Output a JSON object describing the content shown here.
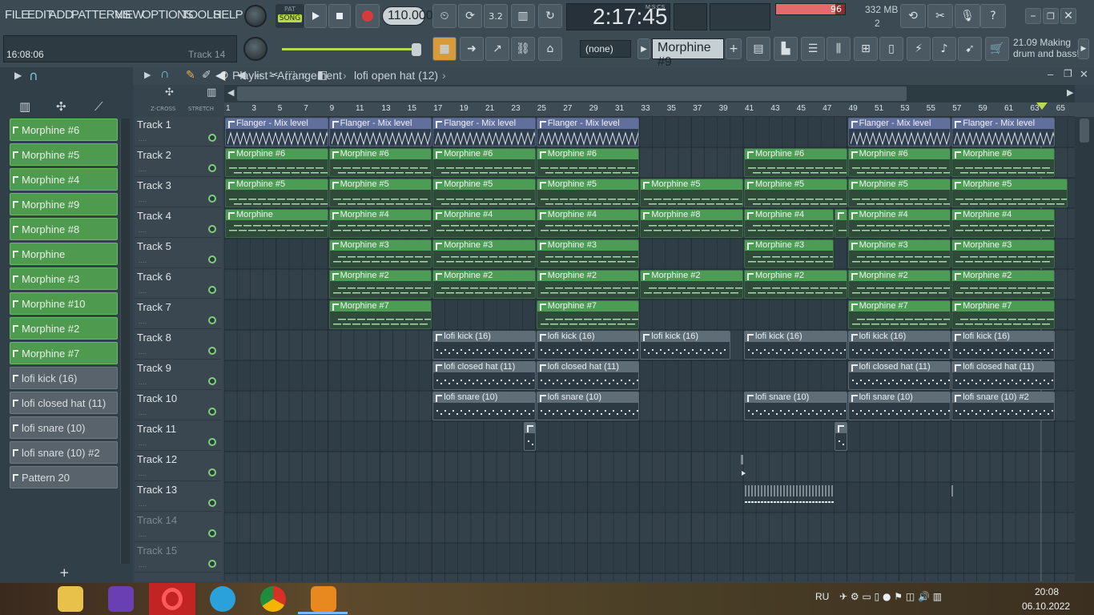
{
  "menu": [
    "FILE",
    "EDIT",
    "ADD",
    "PATTERNS",
    "VIEW",
    "OPTIONS",
    "TOOLS",
    "HELP"
  ],
  "transport": {
    "pat_label": "PAT",
    "song_label": "SONG",
    "tempo": "110.000",
    "time": "2:17:45",
    "time_unit": "M:S:CS"
  },
  "cpu": {
    "percent": "96",
    "memory": "332 MB",
    "voices": "2"
  },
  "status": {
    "clock": "16:08:06",
    "track_hint": "Track 14"
  },
  "pattern_selector": {
    "snap": "(none)",
    "current": "Morphine #9"
  },
  "hint_panel": {
    "line1": "21.09  Making",
    "line2": "drum and bass!"
  },
  "playlist": {
    "title": "Playlist - Arrangement",
    "breadcrumb": "lofi open hat (12)",
    "zcross": "Z-CROSS",
    "stretch": "STRETCH"
  },
  "browser_patterns": [
    {
      "label": "Morphine #6",
      "kind": "g"
    },
    {
      "label": "Morphine #5",
      "kind": "g"
    },
    {
      "label": "Morphine #4",
      "kind": "g"
    },
    {
      "label": "Morphine #9",
      "kind": "g"
    },
    {
      "label": "Morphine #8",
      "kind": "g"
    },
    {
      "label": "Morphine",
      "kind": "g"
    },
    {
      "label": "Morphine #3",
      "kind": "g"
    },
    {
      "label": "Morphine #10",
      "kind": "g"
    },
    {
      "label": "Morphine #2",
      "kind": "g"
    },
    {
      "label": "Morphine #7",
      "kind": "g"
    },
    {
      "label": "lofi kick (16)",
      "kind": "a"
    },
    {
      "label": "lofi closed hat (11)",
      "kind": "a"
    },
    {
      "label": "lofi snare (10)",
      "kind": "a"
    },
    {
      "label": "lofi snare (10) #2",
      "kind": "a"
    },
    {
      "label": "Pattern 20",
      "kind": "a"
    }
  ],
  "ruler_ticks": [
    "1",
    "3",
    "5",
    "7",
    "9",
    "11",
    "13",
    "15",
    "17",
    "19",
    "21",
    "23",
    "25",
    "27",
    "29",
    "31",
    "33",
    "35",
    "37",
    "39",
    "41",
    "43",
    "45",
    "47",
    "49",
    "51",
    "53",
    "55",
    "57",
    "59",
    "61",
    "63",
    "65"
  ],
  "tracks": [
    "Track 1",
    "Track 2",
    "Track 3",
    "Track 4",
    "Track 5",
    "Track 6",
    "Track 7",
    "Track 8",
    "Track 9",
    "Track 10",
    "Track 11",
    "Track 12",
    "Track 13",
    "Track 14",
    "Track 15"
  ],
  "clips": [
    {
      "track": 1,
      "start": 1,
      "len": 8,
      "label": "Flanger - Mix level",
      "kind": "f"
    },
    {
      "track": 1,
      "start": 9,
      "len": 8,
      "label": "Flanger - Mix level",
      "kind": "f"
    },
    {
      "track": 1,
      "start": 17,
      "len": 8,
      "label": "Flanger - Mix level",
      "kind": "f"
    },
    {
      "track": 1,
      "start": 25,
      "len": 8,
      "label": "Flanger - Mix level",
      "kind": "f"
    },
    {
      "track": 1,
      "start": 49,
      "len": 8,
      "label": "Flanger - Mix level",
      "kind": "f"
    },
    {
      "track": 1,
      "start": 57,
      "len": 8,
      "label": "Flanger - Mix level",
      "kind": "f"
    },
    {
      "track": 2,
      "start": 1,
      "len": 8,
      "label": "Morphine #6",
      "kind": "g"
    },
    {
      "track": 2,
      "start": 9,
      "len": 8,
      "label": "Morphine #6",
      "kind": "g"
    },
    {
      "track": 2,
      "start": 17,
      "len": 8,
      "label": "Morphine #6",
      "kind": "g"
    },
    {
      "track": 2,
      "start": 25,
      "len": 8,
      "label": "Morphine #6",
      "kind": "g"
    },
    {
      "track": 2,
      "start": 41,
      "len": 8,
      "label": "Morphine #6",
      "kind": "g"
    },
    {
      "track": 2,
      "start": 49,
      "len": 8,
      "label": "Morphine #6",
      "kind": "g"
    },
    {
      "track": 2,
      "start": 57,
      "len": 8,
      "label": "Morphine #6",
      "kind": "g"
    },
    {
      "track": 3,
      "start": 1,
      "len": 8,
      "label": "Morphine #5",
      "kind": "g"
    },
    {
      "track": 3,
      "start": 9,
      "len": 8,
      "label": "Morphine #5",
      "kind": "g"
    },
    {
      "track": 3,
      "start": 17,
      "len": 8,
      "label": "Morphine #5",
      "kind": "g"
    },
    {
      "track": 3,
      "start": 25,
      "len": 8,
      "label": "Morphine #5",
      "kind": "g"
    },
    {
      "track": 3,
      "start": 33,
      "len": 8,
      "label": "Morphine #5",
      "kind": "g"
    },
    {
      "track": 3,
      "start": 41,
      "len": 8,
      "label": "Morphine #5",
      "kind": "g"
    },
    {
      "track": 3,
      "start": 49,
      "len": 8,
      "label": "Morphine #5",
      "kind": "g"
    },
    {
      "track": 3,
      "start": 57,
      "len": 9,
      "label": "Morphine #5",
      "kind": "g"
    },
    {
      "track": 4,
      "start": 1,
      "len": 8,
      "label": "Morphine",
      "kind": "g"
    },
    {
      "track": 4,
      "start": 9,
      "len": 8,
      "label": "Morphine #4",
      "kind": "g"
    },
    {
      "track": 4,
      "start": 17,
      "len": 8,
      "label": "Morphine #4",
      "kind": "g"
    },
    {
      "track": 4,
      "start": 25,
      "len": 8,
      "label": "Morphine #4",
      "kind": "g"
    },
    {
      "track": 4,
      "start": 33,
      "len": 8,
      "label": "Morphine #8",
      "kind": "g"
    },
    {
      "track": 4,
      "start": 41,
      "len": 7,
      "label": "Morphine #4",
      "kind": "g"
    },
    {
      "track": 4,
      "start": 48,
      "len": 1,
      "label": "",
      "kind": "g"
    },
    {
      "track": 4,
      "start": 49,
      "len": 8,
      "label": "Morphine #4",
      "kind": "g"
    },
    {
      "track": 4,
      "start": 57,
      "len": 8,
      "label": "Morphine #4",
      "kind": "g"
    },
    {
      "track": 5,
      "start": 9,
      "len": 8,
      "label": "Morphine #3",
      "kind": "g"
    },
    {
      "track": 5,
      "start": 17,
      "len": 8,
      "label": "Morphine #3",
      "kind": "g"
    },
    {
      "track": 5,
      "start": 25,
      "len": 8,
      "label": "Morphine #3",
      "kind": "g"
    },
    {
      "track": 5,
      "start": 41,
      "len": 7,
      "label": "Morphine #3",
      "kind": "g"
    },
    {
      "track": 5,
      "start": 49,
      "len": 8,
      "label": "Morphine #3",
      "kind": "g"
    },
    {
      "track": 5,
      "start": 57,
      "len": 8,
      "label": "Morphine #3",
      "kind": "g"
    },
    {
      "track": 6,
      "start": 9,
      "len": 8,
      "label": "Morphine #2",
      "kind": "g"
    },
    {
      "track": 6,
      "start": 17,
      "len": 8,
      "label": "Morphine #2",
      "kind": "g"
    },
    {
      "track": 6,
      "start": 25,
      "len": 8,
      "label": "Morphine #2",
      "kind": "g"
    },
    {
      "track": 6,
      "start": 33,
      "len": 8,
      "label": "Morphine #2",
      "kind": "g"
    },
    {
      "track": 6,
      "start": 41,
      "len": 8,
      "label": "Morphine #2",
      "kind": "g"
    },
    {
      "track": 6,
      "start": 49,
      "len": 8,
      "label": "Morphine #2",
      "kind": "g"
    },
    {
      "track": 6,
      "start": 57,
      "len": 8,
      "label": "Morphine #2",
      "kind": "g"
    },
    {
      "track": 7,
      "start": 9,
      "len": 8,
      "label": "Morphine #7",
      "kind": "g"
    },
    {
      "track": 7,
      "start": 25,
      "len": 8,
      "label": "Morphine #7",
      "kind": "g"
    },
    {
      "track": 7,
      "start": 49,
      "len": 8,
      "label": "Morphine #7",
      "kind": "g"
    },
    {
      "track": 7,
      "start": 57,
      "len": 8,
      "label": "Morphine #7",
      "kind": "g"
    },
    {
      "track": 8,
      "start": 17,
      "len": 8,
      "label": "lofi kick (16)",
      "kind": "s"
    },
    {
      "track": 8,
      "start": 25,
      "len": 8,
      "label": "lofi kick (16)",
      "kind": "s"
    },
    {
      "track": 8,
      "start": 33,
      "len": 7,
      "label": "lofi kick (16)",
      "kind": "s"
    },
    {
      "track": 8,
      "start": 41,
      "len": 8,
      "label": "lofi kick (16)",
      "kind": "s"
    },
    {
      "track": 8,
      "start": 49,
      "len": 8,
      "label": "lofi kick (16)",
      "kind": "s"
    },
    {
      "track": 8,
      "start": 57,
      "len": 8,
      "label": "lofi kick (16)",
      "kind": "s"
    },
    {
      "track": 9,
      "start": 17,
      "len": 8,
      "label": "lofi closed hat (11)",
      "kind": "s"
    },
    {
      "track": 9,
      "start": 25,
      "len": 8,
      "label": "lofi closed hat (11)",
      "kind": "s"
    },
    {
      "track": 9,
      "start": 49,
      "len": 8,
      "label": "lofi closed hat (11)",
      "kind": "s"
    },
    {
      "track": 9,
      "start": 57,
      "len": 8,
      "label": "lofi closed hat (11)",
      "kind": "s"
    },
    {
      "track": 10,
      "start": 17,
      "len": 8,
      "label": "lofi snare (10)",
      "kind": "s"
    },
    {
      "track": 10,
      "start": 25,
      "len": 8,
      "label": "lofi snare (10)",
      "kind": "s"
    },
    {
      "track": 10,
      "start": 41,
      "len": 8,
      "label": "lofi snare (10)",
      "kind": "s"
    },
    {
      "track": 10,
      "start": 49,
      "len": 8,
      "label": "lofi snare (10)",
      "kind": "s"
    },
    {
      "track": 10,
      "start": 57,
      "len": 8,
      "label": "lofi snare (10) #2",
      "kind": "s"
    },
    {
      "track": 11,
      "start": 24,
      "len": 1,
      "label": "",
      "kind": "s"
    },
    {
      "track": 11,
      "start": 48,
      "len": 1,
      "label": "",
      "kind": "s"
    }
  ],
  "taskbar": {
    "lang": "RU",
    "time": "20:08",
    "date": "06.10.2022"
  }
}
